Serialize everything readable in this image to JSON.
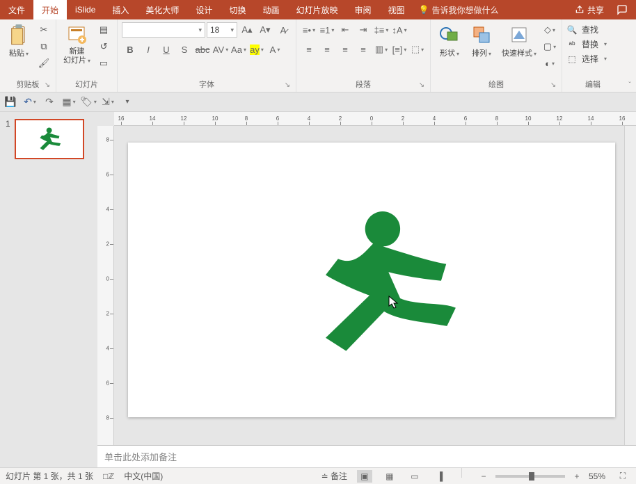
{
  "tabs": {
    "file": "文件",
    "home": "开始",
    "islide": "iSlide",
    "insert": "插入",
    "beautify": "美化大师",
    "design": "设计",
    "transition": "切换",
    "animation": "动画",
    "slideshow": "幻灯片放映",
    "review": "审阅",
    "view": "视图"
  },
  "tellme": "告诉我你想做什么",
  "share": "共享",
  "ribbon": {
    "clipboard": {
      "label": "剪贴板",
      "paste": "粘贴"
    },
    "slides": {
      "label": "幻灯片",
      "new": "新建\n幻灯片"
    },
    "font": {
      "label": "字体",
      "size": "18"
    },
    "paragraph": {
      "label": "段落"
    },
    "drawing": {
      "label": "绘图",
      "shapes": "形状",
      "arrange": "排列",
      "quick": "快速样式"
    },
    "editing": {
      "label": "编辑",
      "find": "查找",
      "replace": "替换",
      "select": "选择"
    }
  },
  "thumbs": {
    "n1": "1"
  },
  "ruler": [
    "16",
    "14",
    "12",
    "10",
    "8",
    "6",
    "4",
    "2",
    "0",
    "2",
    "4",
    "6",
    "8",
    "10",
    "12",
    "14",
    "16"
  ],
  "vruler": [
    "8",
    "6",
    "4",
    "2",
    "0",
    "2",
    "4",
    "6",
    "8"
  ],
  "notes_placeholder": "单击此处添加备注",
  "status": {
    "slide": "幻灯片 第 1 张，共 1 张",
    "lang": "中文(中国)",
    "notes": "备注",
    "zoom": "55%"
  }
}
